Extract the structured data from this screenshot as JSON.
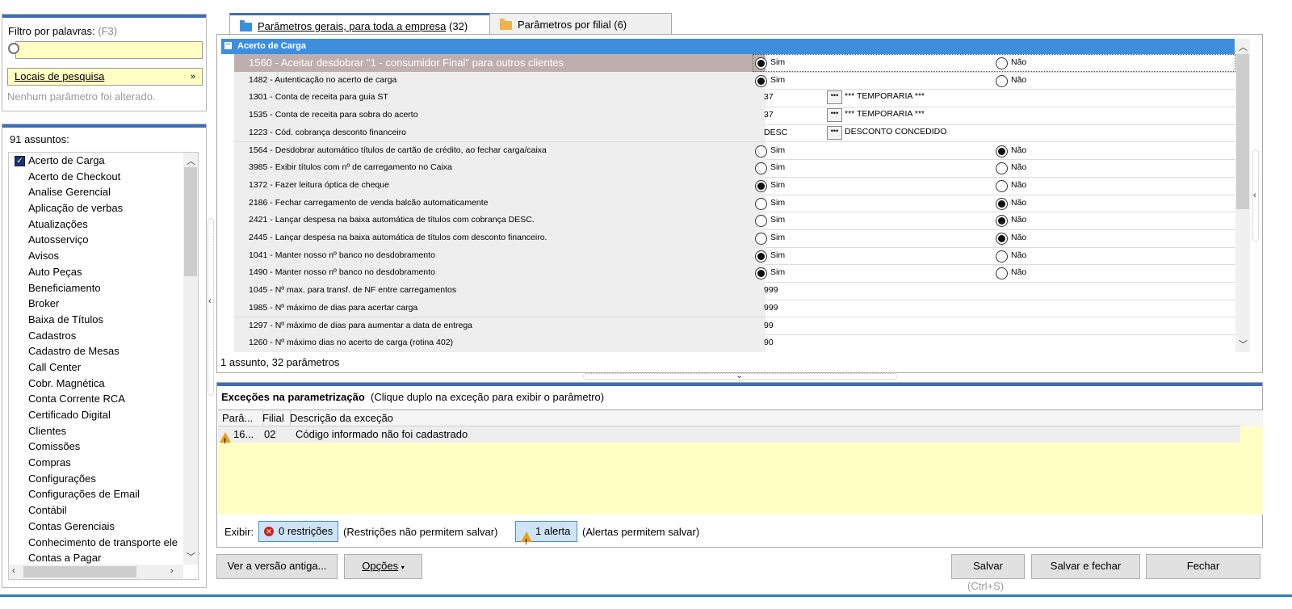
{
  "filter": {
    "label": "Filtro por palavras:",
    "shortcut": "(F3)",
    "value": "",
    "search_locations": "Locais de pesquisa",
    "status": "Nenhum parâmetro foi alterado."
  },
  "subjects": {
    "count_label": "91 assuntos:",
    "items": [
      "Acerto de Carga",
      "Acerto de Checkout",
      "Analise Gerencial",
      "Aplicação de verbas",
      "Atualizações",
      "Autosserviço",
      "Avisos",
      "Auto Peças",
      "Beneficiamento",
      "Broker",
      "Baixa de Títulos",
      "Cadastros",
      "Cadastro de Mesas",
      "Call Center",
      "Cobr. Magnética",
      "Conta Corrente RCA",
      "Certificado Digital",
      "Clientes",
      "Comissões",
      "Compras",
      "Configurações",
      "Configurações de Email",
      "Contábil",
      "Contas Gerenciais",
      "Conhecimento de transporte ele",
      "Contas a Pagar"
    ]
  },
  "tabs": [
    {
      "label": "Parâmetros gerais, para toda a empresa",
      "count": "(32)"
    },
    {
      "label": "Parâmetros por filial",
      "count": "(6)"
    }
  ],
  "group": {
    "title": "Acerto de Carga",
    "toggle": "−"
  },
  "params": [
    {
      "label": "1560 - Aceitar desdobrar \"1 - consumidor Final\" para outros clientes",
      "sim": "Sim",
      "nao": "Não"
    },
    {
      "label": "1482 - Autenticação no acerto de carga",
      "sim": "Sim",
      "nao": "Não"
    },
    {
      "label": "1301 - Conta de receita para guia ST",
      "value": "37",
      "desc": "*** TEMPORARIA ***"
    },
    {
      "label": "1535 - Conta de receita para sobra do acerto",
      "value": "37",
      "desc": "*** TEMPORARIA ***"
    },
    {
      "label": "1223 - Cód. cobrança desconto financeiro",
      "value": "DESC",
      "desc": "DESCONTO CONCEDIDO"
    },
    {
      "label": "1564 - Desdobrar automático títulos de cartão de crédito, ao fechar carga/caixa",
      "sim": "Sim",
      "nao": "Não"
    },
    {
      "label": "3985 - Exibir títulos com nº de carregamento no Caixa",
      "sim": "Sim",
      "nao": "Não"
    },
    {
      "label": "1372 - Fazer leitura óptica de cheque",
      "sim": "Sim",
      "nao": "Não"
    },
    {
      "label": "2186 - Fechar carregamento de venda balcão automaticamente",
      "sim": "Sim",
      "nao": "Não"
    },
    {
      "label": "2421 - Lançar despesa na baixa automática de títulos com cobrança DESC.",
      "sim": "Sim",
      "nao": "Não"
    },
    {
      "label": "2445 - Lançar despesa na baixa automática de títulos com desconto financeiro.",
      "sim": "Sim",
      "nao": "Não"
    },
    {
      "label": "1041 - Manter nosso nº banco no desdobramento",
      "sim": "Sim",
      "nao": "Não"
    },
    {
      "label": "1490 - Manter nosso nº banco no desdobramento",
      "sim": "Sim",
      "nao": "Não"
    },
    {
      "label": "1045 - Nº max. para transf. de NF entre carregamentos",
      "value": "999"
    },
    {
      "label": "1985 - Nº máximo de dias para acertar carga",
      "value": "999"
    },
    {
      "label": "1297 - Nº máximo de dias para aumentar a data de entrega",
      "value": "99"
    },
    {
      "label": "1260 - Nº máximo dias no acerto de carga (rotina 402)",
      "value": "90"
    }
  ],
  "summary": "1 assunto, 32 parâmetros",
  "exceptions": {
    "title": "Exceções na parametrização",
    "hint": "(Clique duplo na exceção para exibir o parâmetro)",
    "columns": [
      "Parâ...",
      "Filial",
      "Descrição da exceção"
    ],
    "rows": [
      {
        "param": "16...",
        "filial": "02",
        "desc": "Código informado não foi cadastrado"
      }
    ]
  },
  "show": {
    "label": "Exibir:",
    "restrictions_btn": "0 restrições",
    "restrictions_note": "(Restrições não permitem salvar)",
    "alerts_btn": "1 alerta",
    "alerts_note": "(Alertas permitem salvar)"
  },
  "footer": {
    "old_version": "Ver a versão antiga...",
    "options": "Opções",
    "save": "Salvar",
    "save_shortcut": "(Ctrl+S)",
    "save_close": "Salvar e fechar",
    "close": "Fechar"
  },
  "colors": {
    "accent": "#3e6db5",
    "yellow": "#ffffc4",
    "selected_row": "#bfaeae"
  }
}
